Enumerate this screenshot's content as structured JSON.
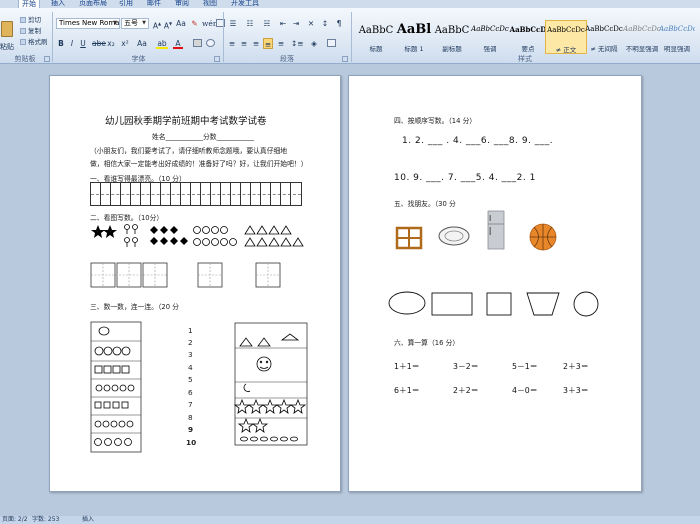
{
  "ribbon": {
    "tabs": [
      "开始",
      "插入",
      "页面布局",
      "引用",
      "邮件",
      "审阅",
      "视图",
      "开发工具"
    ],
    "active_tab": "开始",
    "clipboard": {
      "paste": "粘贴",
      "cut": "剪切",
      "copy": "复制",
      "format_painter": "格式刷",
      "group_label": "剪贴板"
    },
    "font": {
      "family": "Times New Roman",
      "size": "五号",
      "group_label": "字体"
    },
    "paragraph": {
      "group_label": "段落"
    },
    "styles": {
      "group_label": "样式",
      "items": [
        {
          "sample": "AaBbC",
          "name": "标题"
        },
        {
          "sample": "AaBl",
          "name": "标题 1"
        },
        {
          "sample": "AaBbC",
          "name": "副标题"
        },
        {
          "sample": "AaBbCcDc",
          "name": "强调"
        },
        {
          "sample": "AaBbCcD",
          "name": "要点"
        },
        {
          "sample": "AaBbCcDc",
          "name": "≠ 正文"
        },
        {
          "sample": "AaBbCcDc",
          "name": "≠ 无间隔"
        },
        {
          "sample": "AaBbCcDc",
          "name": "不明显强调"
        },
        {
          "sample": "AaBbCcDc",
          "name": "明显强调"
        }
      ]
    }
  },
  "doc": {
    "title": "幼儿园秋季期学前班期中考试数学试卷",
    "name_line": "姓名___________分数___________",
    "intro1": "（小朋友们，我们要考试了，请仔细听教师念题哦，要认真仔细地",
    "intro2": "做，相信大家一定能考出好成绩的！准备好了吗？好，让我们开始吧！）",
    "q1": "一、看谁写得最漂亮。（10 分）",
    "q2": "二、看图写数。（10分）",
    "q3": "三、数一数，连一连。（20 分",
    "q3_numbers": [
      "1",
      "2",
      "3",
      "4",
      "5",
      "6",
      "7",
      "8",
      "9",
      "10"
    ],
    "q4": "四、按顺序写数。（14 分）",
    "q4_seq1": "1. 2. ___ . 4. ___6. ___8. 9. ___.",
    "q4_seq2": "10. 9. ___. 7. ___5. 4. ___2. 1",
    "q5": "五、找朋友。（30 分",
    "q6": "六、算一算（16 分）",
    "q6_row1": [
      "1＋1＝",
      "3－2＝",
      "5－1＝",
      "2＋3＝"
    ],
    "q6_row2": [
      "6＋1＝",
      "2＋2＝",
      "4－0＝",
      "3＋3＝"
    ]
  },
  "status": {
    "pages": "页面: 2/2",
    "words": "字数: 253",
    "mode": "插入"
  },
  "colors": {
    "ribbon_bg": "#dbe6f3",
    "workspace_bg": "#b9c9dd",
    "text_blue": "#1e395b",
    "selected_style": "#fde8a6"
  }
}
